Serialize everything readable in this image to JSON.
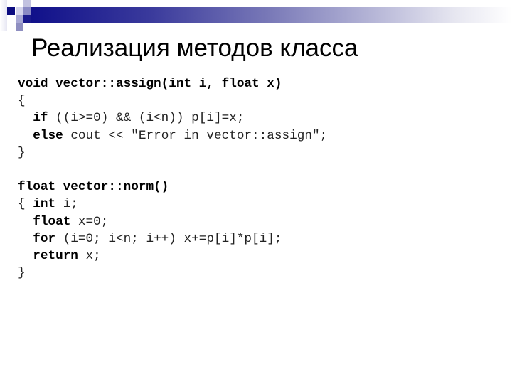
{
  "slide": {
    "title": "Реализация методов класса",
    "code_lines": [
      [
        {
          "t": "void vector::assign(int i, float x)",
          "b": true
        }
      ],
      [
        {
          "t": "{",
          "b": false
        }
      ],
      [
        {
          "t": "  ",
          "b": false
        },
        {
          "t": "if",
          "b": true
        },
        {
          "t": " ((i>=0) && (i<n)) p[i]=x;",
          "b": false
        }
      ],
      [
        {
          "t": "  ",
          "b": false
        },
        {
          "t": "else",
          "b": true
        },
        {
          "t": " cout << \"Error in vector::assign\";",
          "b": false
        }
      ],
      [
        {
          "t": "}",
          "b": false
        }
      ],
      [
        {
          "t": "",
          "b": false
        }
      ],
      [
        {
          "t": "float vector::norm()",
          "b": true
        }
      ],
      [
        {
          "t": "{ ",
          "b": false
        },
        {
          "t": "int",
          "b": true
        },
        {
          "t": " i;",
          "b": false
        }
      ],
      [
        {
          "t": "  ",
          "b": false
        },
        {
          "t": "float",
          "b": true
        },
        {
          "t": " x=0;",
          "b": false
        }
      ],
      [
        {
          "t": "  ",
          "b": false
        },
        {
          "t": "for",
          "b": true
        },
        {
          "t": " (i=0; i<n; i++) x+=p[i]*p[i];",
          "b": false
        }
      ],
      [
        {
          "t": "  ",
          "b": false
        },
        {
          "t": "return",
          "b": true
        },
        {
          "t": " x;",
          "b": false
        }
      ],
      [
        {
          "t": "}",
          "b": false
        }
      ]
    ]
  },
  "colors": {
    "accent_dark": "#10108a",
    "accent_light": "#b8b8d8"
  }
}
